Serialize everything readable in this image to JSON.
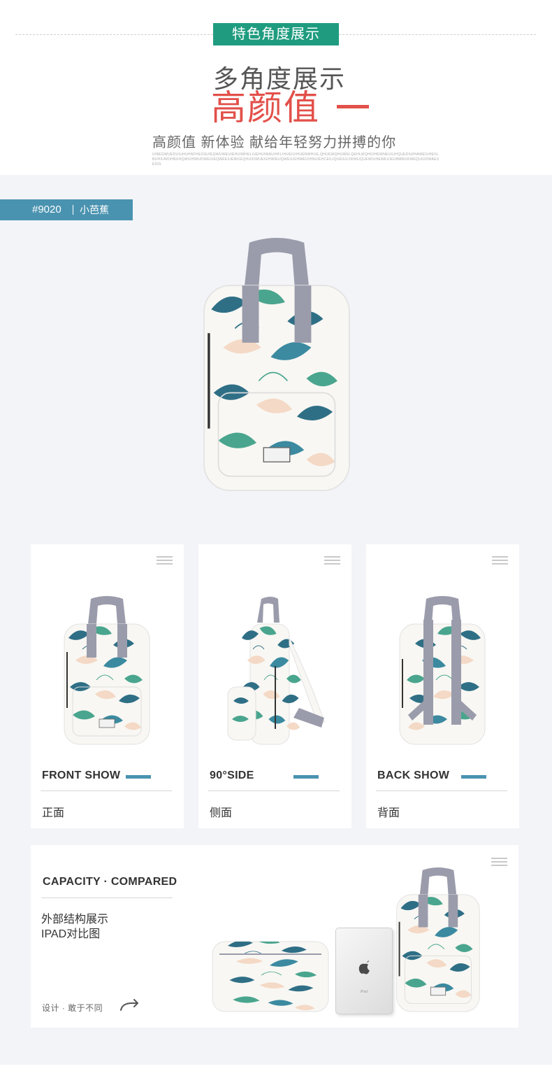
{
  "header": {
    "badge": "特色角度展示",
    "title_line1": "多角度展示",
    "title_line2": "高颜值",
    "slogan": "高颜值 新体验 献给年轻努力拼搏的你",
    "fine_print": "UIBEGWUEDUIUHUHNFHEOSUIEQWUWEUIEHUIWHELIUEHUIWAUIHFLIHUEIUIHUENWHUE,QHUEWQHUWELQEHLWQHUIHEWNEUIUHQUEDIUIHAWEIUHEIU,BUHIUWDHNUHQWUIHWUDWEIUEQWEEIUEWUEQHUIOWUEIGHWIEUQWEUIGHWEUIHNUIEHCEILIQUEIUUJRNIUQUEWIUHEWEUIEUBMNUKWEQUIUDWAEUEIDS"
  },
  "product": {
    "code": "#9020",
    "name": "小芭蕉"
  },
  "views": [
    {
      "title_en": "FRONT SHOW",
      "title_cn": "正面"
    },
    {
      "title_en": "90°SIDE",
      "title_cn": "侧面"
    },
    {
      "title_en": "BACK SHOW",
      "title_cn": "背面"
    }
  ],
  "capacity": {
    "title": "CAPACITY · COMPARED",
    "line1": "外部结构展示",
    "line2": "IPAD对比图",
    "footer": "设计 · 敢于不同",
    "ipad_text": "iPad"
  },
  "colors": {
    "badge_green": "#1f9c7f",
    "accent_red": "#e2504a",
    "accent_blue": "#4a93b0",
    "panel_bg": "#f3f4f8",
    "strap_grey": "#9a9cab",
    "leaf_teal": "#2f6f86",
    "leaf_green": "#4aa58e",
    "leaf_peach": "#f4d9c6"
  },
  "icons": [
    "menu-icon",
    "share-arrow-icon",
    "apple-logo-icon"
  ]
}
